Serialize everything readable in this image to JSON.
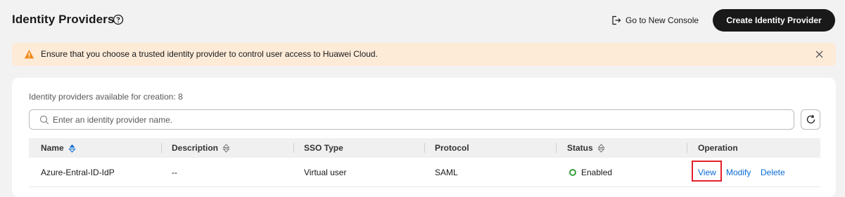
{
  "header": {
    "title": "Identity Providers",
    "go_new_console": "Go to New Console",
    "create_button": "Create Identity Provider"
  },
  "alert": {
    "text": "Ensure that you choose a trusted identity provider to control user access to Huawei Cloud.",
    "color": "#fdebd8",
    "icon_color": "#f08a1b"
  },
  "card": {
    "available_text": "Identity providers available for creation: 8",
    "search_placeholder": "Enter an identity provider name.",
    "search_value": ""
  },
  "table": {
    "columns": [
      "Name",
      "Description",
      "SSO Type",
      "Protocol",
      "Status",
      "Operation"
    ],
    "rows": [
      {
        "name": "Azure-Entral-ID-IdP",
        "description": "--",
        "sso_type": "Virtual user",
        "protocol": "SAML",
        "status": "Enabled",
        "actions": [
          "View",
          "Modify",
          "Delete"
        ]
      }
    ]
  },
  "colors": {
    "primary_button": "#191919",
    "link": "#0a6ad6",
    "status_enabled": "#35a03b",
    "highlight": "#e3202a"
  }
}
